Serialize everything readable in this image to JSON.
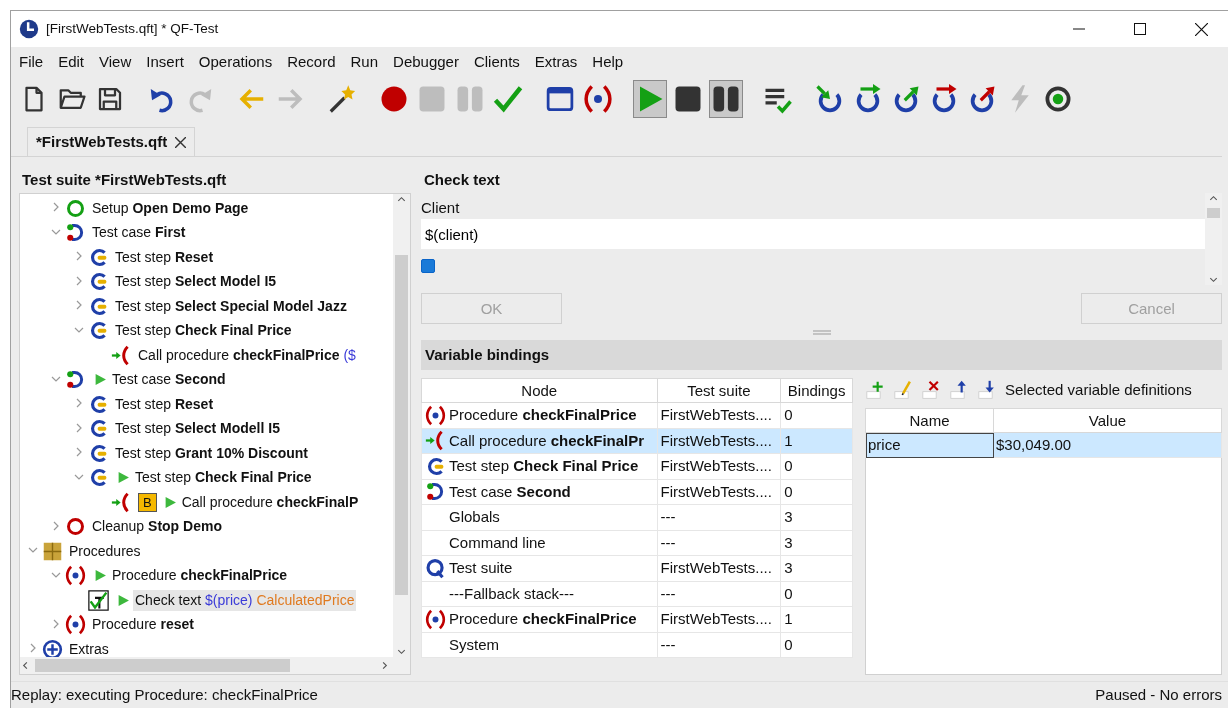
{
  "window": {
    "title": "[FirstWebTests.qft] * QF-Test"
  },
  "menu": [
    "File",
    "Edit",
    "View",
    "Insert",
    "Operations",
    "Record",
    "Run",
    "Debugger",
    "Clients",
    "Extras",
    "Help"
  ],
  "toolbar": [
    [
      {
        "kind": "new",
        "disabled": false,
        "pressed": false
      },
      {
        "kind": "open",
        "disabled": false,
        "pressed": false
      },
      {
        "kind": "save",
        "disabled": false,
        "pressed": false
      }
    ],
    [
      {
        "kind": "undo",
        "disabled": false,
        "pressed": false
      },
      {
        "kind": "redo",
        "disabled": true,
        "pressed": false
      }
    ],
    [
      {
        "kind": "back",
        "disabled": false,
        "pressed": false
      },
      {
        "kind": "forward",
        "disabled": true,
        "pressed": false
      }
    ],
    [
      {
        "kind": "wand",
        "disabled": false,
        "pressed": false
      }
    ],
    [
      {
        "kind": "record",
        "disabled": false,
        "pressed": false
      },
      {
        "kind": "stop",
        "disabled": true,
        "pressed": false
      },
      {
        "kind": "pause",
        "disabled": true,
        "pressed": false
      },
      {
        "kind": "check",
        "disabled": false,
        "pressed": false
      }
    ],
    [
      {
        "kind": "window",
        "disabled": false,
        "pressed": false
      },
      {
        "kind": "procedure",
        "disabled": false,
        "pressed": false
      }
    ],
    [
      {
        "kind": "play",
        "disabled": false,
        "pressed": true
      },
      {
        "kind": "stop",
        "disabled": false,
        "pressed": false
      },
      {
        "kind": "pause",
        "disabled": false,
        "pressed": true
      }
    ],
    [
      {
        "kind": "listcheck",
        "disabled": false,
        "pressed": false
      }
    ],
    [
      {
        "kind": "step-in",
        "disabled": false,
        "pressed": false
      },
      {
        "kind": "step-over",
        "disabled": false,
        "pressed": false
      },
      {
        "kind": "step-out",
        "disabled": false,
        "pressed": false
      },
      {
        "kind": "skip-over",
        "disabled": false,
        "pressed": false
      },
      {
        "kind": "skip-out",
        "disabled": false,
        "pressed": false
      },
      {
        "kind": "lightning",
        "disabled": true,
        "pressed": false
      },
      {
        "kind": "target",
        "disabled": false,
        "pressed": false
      }
    ]
  ],
  "tabs": [
    {
      "label": "*FirstWebTests.qft",
      "selected": true
    }
  ],
  "tree": {
    "title": "Test suite *FirstWebTests.qft",
    "nodes": [
      {
        "children": [
          {
            "kind": "setup",
            "label": "Setup **Open Demo Page**",
            "expanded": false,
            "running": false,
            "selected": false
          },
          {
            "kind": "testcase",
            "label": "Test case **First**",
            "expanded": true,
            "running": false,
            "selected": false,
            "children": [
              {
                "kind": "teststep",
                "label": "Test step **Reset**",
                "expanded": false,
                "running": false,
                "selected": false
              },
              {
                "kind": "teststep",
                "label": "Test step **Select Model I5**",
                "expanded": false,
                "running": false,
                "selected": false
              },
              {
                "kind": "teststep",
                "label": "Test step **Select Special Model Jazz**",
                "expanded": false,
                "running": false,
                "selected": false
              },
              {
                "kind": "teststep",
                "label": "Test step **Check Final Price**",
                "expanded": true,
                "running": false,
                "selected": false,
                "children": [
                  {
                    "kind": "call",
                    "label": "Call procedure **checkFinalPrice**",
                    "args": "($",
                    "running": false,
                    "selected": false
                  }
                ]
              }
            ]
          },
          {
            "kind": "testcase",
            "label": "Test case **Second**",
            "expanded": true,
            "running": true,
            "selected": false,
            "children": [
              {
                "kind": "teststep",
                "label": "Test step **Reset**",
                "expanded": false,
                "running": false,
                "selected": false
              },
              {
                "kind": "teststep",
                "label": "Test step **Select Modell I5**",
                "expanded": false,
                "running": false,
                "selected": false
              },
              {
                "kind": "teststep",
                "label": "Test step **Grant 10% Discount**",
                "expanded": false,
                "running": false,
                "selected": false
              },
              {
                "kind": "teststep",
                "label": "Test step **Check Final Price**",
                "expanded": true,
                "running": true,
                "selected": false,
                "children": [
                  {
                    "kind": "call",
                    "badge": "B",
                    "label": "Call procedure **checkFinalP**",
                    "running": true,
                    "selected": false
                  }
                ]
              }
            ]
          },
          {
            "kind": "cleanup",
            "label": "Cleanup **Stop Demo**",
            "expanded": false,
            "running": false,
            "selected": false
          }
        ]
      },
      {
        "kind": "procedures",
        "label": "Procedures",
        "expanded": true,
        "running": false,
        "selected": false,
        "children": [
          {
            "kind": "procedure",
            "label": "Procedure **checkFinalPrice**",
            "expanded": true,
            "running": true,
            "selected": false,
            "children": [
              {
                "kind": "checktext",
                "label": "Check text",
                "args": "$(price)",
                "target": "CalculatedPrice",
                "running": true,
                "selected": true
              }
            ]
          },
          {
            "kind": "procedure",
            "label": "Procedure **reset**",
            "expanded": false,
            "running": false,
            "selected": false
          }
        ]
      },
      {
        "kind": "extras",
        "label": "Extras",
        "expanded": false,
        "running": false,
        "selected": false
      }
    ]
  },
  "detail": {
    "title": "Check text",
    "client_label": "Client",
    "client_value": "$(client)",
    "component_checkbox": {
      "checked": true
    },
    "buttons": [
      {
        "label": "OK",
        "disabled": true
      },
      {
        "label": "Cancel",
        "disabled": true
      }
    ]
  },
  "bindings": {
    "title": "Variable bindings",
    "columns": [
      "Node",
      "Test suite",
      "Bindings"
    ],
    "rows": [
      {
        "kind": "procedure",
        "node": "Procedure **checkFinalPrice**",
        "suite": "FirstWebTests....",
        "bindings": "0",
        "selected": false
      },
      {
        "kind": "call",
        "node": "Call procedure **checkFinalPr**",
        "suite": "FirstWebTests....",
        "bindings": "1",
        "selected": true
      },
      {
        "kind": "teststep",
        "node": "Test step **Check Final Price**",
        "suite": "FirstWebTests....",
        "bindings": "0",
        "selected": false
      },
      {
        "kind": "testcase",
        "node": "Test case **Second**",
        "suite": "FirstWebTests....",
        "bindings": "0",
        "selected": false
      },
      {
        "kind": "plain",
        "node": "Globals",
        "suite": "---",
        "bindings": "3",
        "selected": false
      },
      {
        "kind": "plain",
        "node": "Command line",
        "suite": "---",
        "bindings": "3",
        "selected": false
      },
      {
        "kind": "testsuite",
        "node": "Test suite",
        "suite": "FirstWebTests....",
        "bindings": "3",
        "selected": false
      },
      {
        "kind": "plain",
        "node": "---Fallback stack---",
        "suite": "---",
        "bindings": "0",
        "selected": false
      },
      {
        "kind": "procedure",
        "node": "Procedure **checkFinalPrice**",
        "suite": "FirstWebTests....",
        "bindings": "1",
        "selected": false
      },
      {
        "kind": "plain",
        "node": "System",
        "suite": "---",
        "bindings": "0",
        "selected": false
      }
    ]
  },
  "definitions": {
    "tools": [
      {
        "kind": "add"
      },
      {
        "kind": "edit"
      },
      {
        "kind": "delete"
      },
      {
        "kind": "up"
      },
      {
        "kind": "down"
      }
    ],
    "label": "Selected variable definitions",
    "columns": [
      "Name",
      "Value"
    ],
    "rows": [
      {
        "name": "price",
        "value": "$30,049.00",
        "selected": true
      }
    ]
  },
  "status_bar": {
    "left": "Replay: executing Procedure: checkFinalPrice",
    "right": "Paused - No errors"
  }
}
